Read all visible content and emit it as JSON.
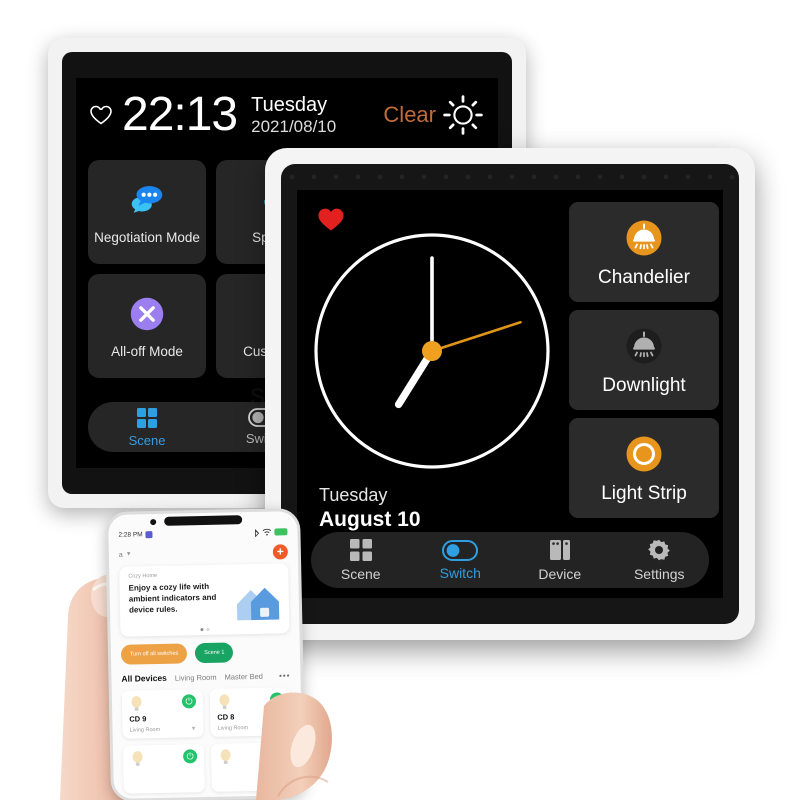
{
  "back_panel": {
    "header": {
      "time": "22:13",
      "weekday": "Tuesday",
      "date": "2021/08/10",
      "condition": "Clear",
      "heart_icon": "heart-outline-icon",
      "weather_icon": "sun-icon"
    },
    "scenes": [
      {
        "label": "Negotiation Mode",
        "icon": "chat-bubbles-icon",
        "color": "#2196f3"
      },
      {
        "label": "Speech",
        "icon": "speaker-icon",
        "color": "#2196f3"
      },
      {
        "label": "",
        "icon": "blank-icon",
        "color": "#333333"
      },
      {
        "label": "All-off Mode",
        "icon": "close-circle-icon",
        "color": "#9b7ff0"
      },
      {
        "label": "Customize",
        "icon": "customize-icon",
        "color": "#7c5cf0"
      },
      {
        "label": "",
        "icon": "blank-icon",
        "color": "#333333"
      }
    ],
    "nav": [
      {
        "label": "Scene",
        "icon": "grid-icon",
        "active": true
      },
      {
        "label": "Switch",
        "icon": "toggle-off-icon",
        "active": false
      }
    ]
  },
  "front_panel": {
    "heart_icon": "heart-solid-icon",
    "clock": {
      "hour_angle": 212,
      "minute_angle": 0,
      "second_angle": 72,
      "hub_color": "#f0a020",
      "second_hand_color": "#e0941a",
      "face_color": "#ffffff"
    },
    "date": {
      "weekday": "Tuesday",
      "day": "August 10"
    },
    "devices": [
      {
        "label": "Chandelier",
        "icon": "ceiling-lamp-icon",
        "state": "on",
        "color": "#e8951e"
      },
      {
        "label": "Downlight",
        "icon": "ceiling-lamp-icon",
        "state": "off",
        "color": "#2a2a2a"
      },
      {
        "label": "Light Strip",
        "icon": "ring-light-icon",
        "state": "on",
        "color": "#e8951e"
      }
    ],
    "nav": [
      {
        "label": "Scene",
        "icon": "grid-icon",
        "active": false
      },
      {
        "label": "Switch",
        "icon": "toggle-on-icon",
        "active": true
      },
      {
        "label": "Device",
        "icon": "device-icon",
        "active": false
      },
      {
        "label": "Settings",
        "icon": "gear-icon",
        "active": false
      }
    ]
  },
  "phone": {
    "status": {
      "time": "2:28 PM",
      "battery_icon": "battery-icon",
      "wifi_icon": "wifi-icon",
      "bluetooth_icon": "bluetooth-icon"
    },
    "header": {
      "location": "a",
      "add_label": "+"
    },
    "banner": {
      "kicker": "Cozy Home",
      "title": "Enjoy a cozy life with ambient indicators and device rules.",
      "art_icon": "house-icon"
    },
    "pills": [
      {
        "label": "Turn off all switches",
        "style": "orange"
      },
      {
        "label": "Scene 1",
        "style": "green"
      }
    ],
    "tabs": [
      {
        "label": "All Devices",
        "active": true
      },
      {
        "label": "Living Room",
        "active": false
      },
      {
        "label": "Master Bed",
        "active": false
      }
    ],
    "tabs_more": "•••",
    "devices": [
      {
        "name": "CD 9",
        "room": "Living Room",
        "power": "on"
      },
      {
        "name": "CD 8",
        "room": "Living Room",
        "power": "on"
      },
      {
        "name": "",
        "room": "",
        "power": "on"
      },
      {
        "name": "",
        "room": "",
        "power": "on"
      }
    ]
  },
  "watermark": {
    "text": "sa"
  }
}
